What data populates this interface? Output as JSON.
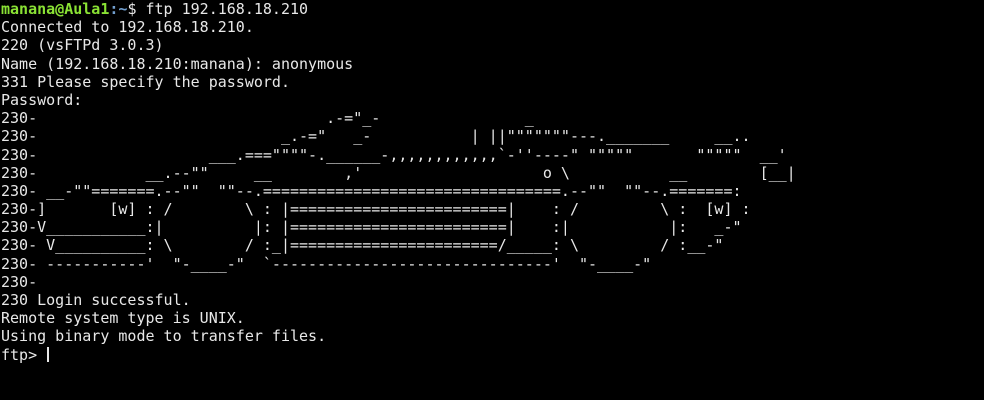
{
  "terminal": {
    "prompt_user": "manana@Aula1",
    "prompt_path": ":~",
    "prompt_symbol": "$ ",
    "command": "ftp 192.168.18.210",
    "output": [
      "Connected to 192.168.18.210.",
      "220 (vsFTPd 3.0.3)",
      "Name (192.168.18.210:manana): anonymous",
      "331 Please specify the password.",
      "Password:",
      "230-                                .-=\"_-                _",
      "230-                           _.-=\"   _-           | ||\"\"\"\"\"\"\"---._______     __..",
      "230-                   ___.===\"\"\"\"-.______-,,,,,,,,,,,,`-''----\" \"\"\"\"\"       \"\"\"\"\"  __'",
      "230-            __.--\"\"     __        ,'                    o \\           __        [__|",
      "230- __-\"\"=======.--\"\"  \"\"--.=================================.--\"\"  \"\"--.=======:",
      "230-]       [w] : /        \\ : |========================|    : /         \\ :  [w] :",
      "230-V___________:|          |: |========================|    :|           |:   _-\"",
      "230- V__________: \\        / :_|=======================/_____: \\         / :__-\"",
      "230- -----------'  \"-____-\"  `-------------------------------'  \"-____-\"",
      "230-",
      "230 Login successful.",
      "Remote system type is UNIX.",
      "Using binary mode to transfer files."
    ],
    "ftp_prompt": "ftp> "
  }
}
